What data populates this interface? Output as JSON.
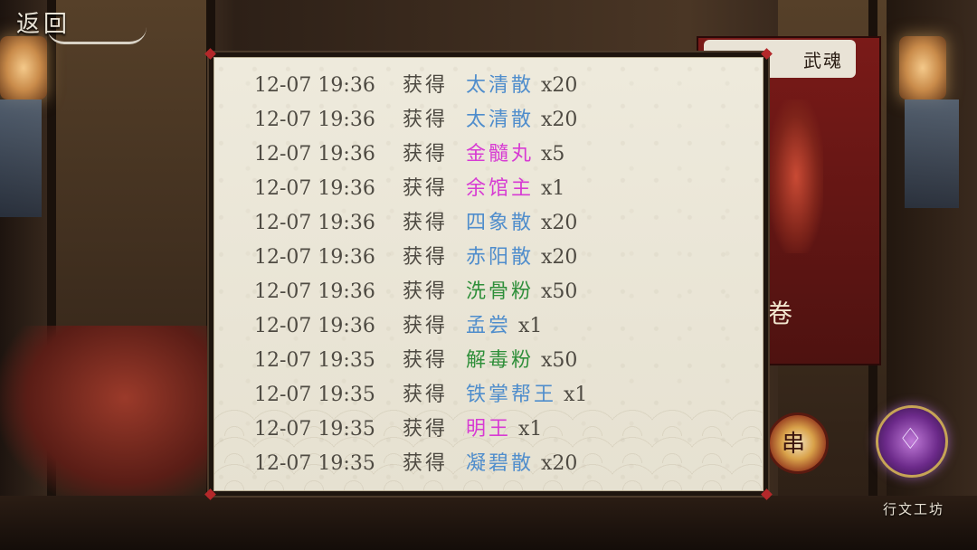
{
  "header": {
    "back_label": "返回"
  },
  "side_banner": {
    "title": "武魂",
    "footer_glyph": "卷"
  },
  "decorations": {
    "drum_glyph": "串",
    "watermark": "行文工坊"
  },
  "colors": {
    "blue_item": "#4f8dcc",
    "magenta_item": "#d73bd3",
    "green_item": "#2f8f3a",
    "text_gray": "#4e4a42"
  },
  "log": {
    "verb": "获得",
    "entries": [
      {
        "time": "12-07 19:36",
        "item": "太清散",
        "qty": "x20",
        "color": "#4f8dcc"
      },
      {
        "time": "12-07 19:36",
        "item": "太清散",
        "qty": "x20",
        "color": "#4f8dcc"
      },
      {
        "time": "12-07 19:36",
        "item": "金髓丸",
        "qty": "x5",
        "color": "#d73bd3"
      },
      {
        "time": "12-07 19:36",
        "item": "余馆主",
        "qty": "x1",
        "color": "#d73bd3"
      },
      {
        "time": "12-07 19:36",
        "item": "四象散",
        "qty": "x20",
        "color": "#4f8dcc"
      },
      {
        "time": "12-07 19:36",
        "item": "赤阳散",
        "qty": "x20",
        "color": "#4f8dcc"
      },
      {
        "time": "12-07 19:36",
        "item": "洗骨粉",
        "qty": "x50",
        "color": "#2f8f3a"
      },
      {
        "time": "12-07 19:36",
        "item": "孟尝",
        "qty": "x1",
        "color": "#4f8dcc"
      },
      {
        "time": "12-07 19:35",
        "item": "解毒粉",
        "qty": "x50",
        "color": "#2f8f3a"
      },
      {
        "time": "12-07 19:35",
        "item": "铁掌帮王",
        "qty": "x1",
        "color": "#4f8dcc"
      },
      {
        "time": "12-07 19:35",
        "item": "明王",
        "qty": "x1",
        "color": "#d73bd3"
      },
      {
        "time": "12-07 19:35",
        "item": "凝碧散",
        "qty": "x20",
        "color": "#4f8dcc"
      }
    ]
  }
}
